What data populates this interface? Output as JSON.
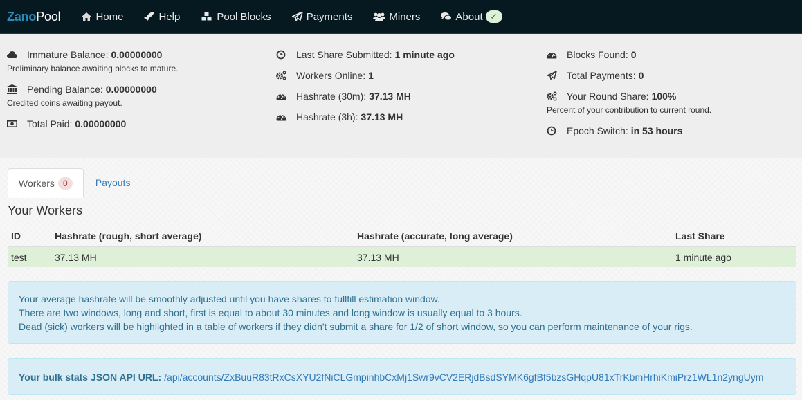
{
  "navbar": {
    "brand_part1": "Zano",
    "brand_part2": "Pool",
    "items": [
      {
        "label": "Home",
        "icon": "home-icon"
      },
      {
        "label": "Help",
        "icon": "rocket-icon"
      },
      {
        "label": "Pool Blocks",
        "icon": "cubes-icon"
      },
      {
        "label": "Payments",
        "icon": "paper-plane-icon"
      },
      {
        "label": "Miners",
        "icon": "users-icon"
      },
      {
        "label": "About",
        "icon": "comments-icon"
      }
    ],
    "status_badge": "✓"
  },
  "stats": {
    "immature_label": "Immature Balance:",
    "immature_value": "0.00000000",
    "immature_sub": "Preliminary balance awaiting blocks to mature.",
    "pending_label": "Pending Balance:",
    "pending_value": "0.00000000",
    "pending_sub": "Credited coins awaiting payout.",
    "paid_label": "Total Paid:",
    "paid_value": "0.00000000",
    "last_share_label": "Last Share Submitted:",
    "last_share_value": "1 minute ago",
    "workers_online_label": "Workers Online:",
    "workers_online_value": "1",
    "hashrate30_label": "Hashrate (30m):",
    "hashrate30_value": "37.13 MH",
    "hashrate3h_label": "Hashrate (3h):",
    "hashrate3h_value": "37.13 MH",
    "blocks_label": "Blocks Found:",
    "blocks_value": "0",
    "payments_label": "Total Payments:",
    "payments_value": "0",
    "round_share_label": "Your Round Share:",
    "round_share_value": "100%",
    "round_share_sub": "Percent of your contribution to current round.",
    "epoch_label": "Epoch Switch:",
    "epoch_value": "in 53 hours"
  },
  "tabs": [
    {
      "label": "Workers",
      "badge": "0",
      "active": true
    },
    {
      "label": "Payouts",
      "active": false
    }
  ],
  "workers": {
    "title": "Your Workers",
    "columns": [
      "ID",
      "Hashrate (rough, short average)",
      "Hashrate (accurate, long average)",
      "Last Share"
    ],
    "rows": [
      [
        "test",
        "37.13 MH",
        "37.13 MH",
        "1 minute ago"
      ]
    ]
  },
  "info_alert": {
    "lines": [
      "Your average hashrate will be smoothly adjusted until you have shares to fullfill estimation window.",
      "There are two windows, long and short, first is equal to about 30 minutes and long window is usually equal to 3 hours.",
      "Dead (sick) workers will be highlighted in a table of workers if they didn't submit a share for 1/2 of short window, so you can perform maintenance of your rigs."
    ]
  },
  "api_alert": {
    "label": "Your bulk stats JSON API URL:",
    "url": "/api/accounts/ZxBuuR83tRxCsXYU2fNiCLGmpinhbCxMj1Swr9vCV2ERjdBsdSYMK6gfBf5bzsGHqpU81xTrKbmHrhiKmiPrz1WL1n2yngUym"
  }
}
